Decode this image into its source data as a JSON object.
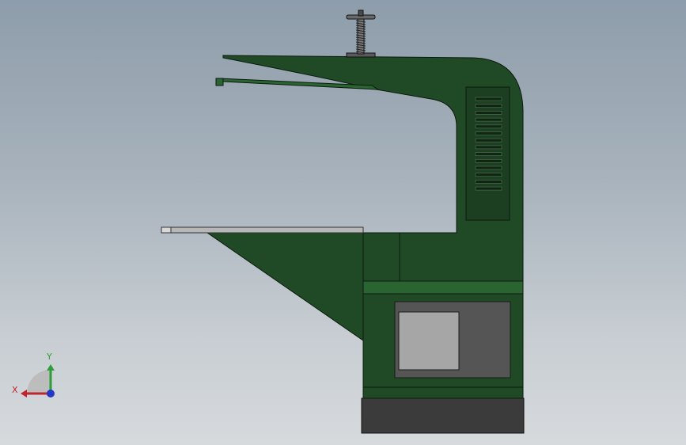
{
  "viewport": {
    "background_top": "#8e9dab",
    "background_bottom": "#d6dadd"
  },
  "model": {
    "body_color": "#1f4a25",
    "body_highlight": "#2a6431",
    "base_color": "#3d3d3d",
    "table_color": "#b7b7b7",
    "panel_color": "#555555",
    "window_color": "#a6a6a6",
    "outline_color": "#0c1a0e"
  },
  "triad": {
    "x_label": "X",
    "y_label": "Y",
    "x_color": "#c0262d",
    "y_color": "#2e9d3a",
    "z_color": "#2337c4"
  }
}
